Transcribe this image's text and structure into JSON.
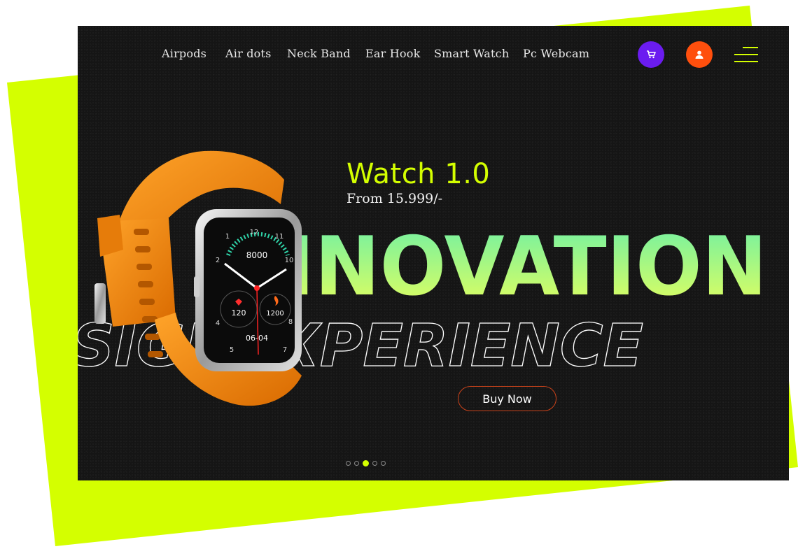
{
  "nav": {
    "items": [
      {
        "label": "Airpods"
      },
      {
        "label": "Air dots"
      },
      {
        "label": "Neck Band"
      },
      {
        "label": "Ear Hook"
      },
      {
        "label": "Smart Watch"
      },
      {
        "label": "Pc Webcam"
      }
    ],
    "cart_icon": "cart-icon",
    "user_icon": "user-icon",
    "menu_icon": "menu-icon"
  },
  "hero": {
    "title": "Watch 1.0",
    "price": "From 15.999/-",
    "big_text": "INOVATION",
    "outline_text": "SIGNEXPERIENCE",
    "cta_label": "Buy Now",
    "slide_count": 5,
    "active_slide": 3
  },
  "watch_face": {
    "steps": "8000",
    "heart": "120",
    "calories": "1200",
    "date": "06-04",
    "hour_numbers": [
      "12",
      "1",
      "2",
      "3",
      "4",
      "5",
      "6",
      "7",
      "8",
      "9",
      "10",
      "11"
    ]
  },
  "colors": {
    "accent": "#d4ff00",
    "cart_button": "#6b1cf0",
    "user_button": "#ff4f0d",
    "panel": "#151515",
    "strap": "#f58a12",
    "cta_border": "#c9421a"
  }
}
